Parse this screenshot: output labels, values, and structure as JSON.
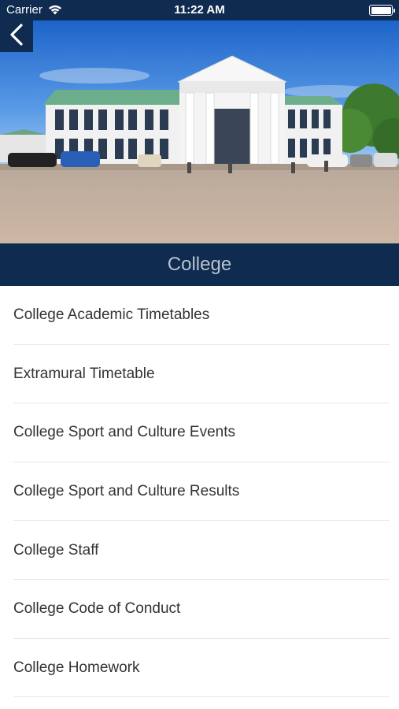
{
  "status_bar": {
    "carrier": "Carrier",
    "time": "11:22 AM",
    "battery_level": 1.0
  },
  "hero": {
    "description_icon": "college-building-photo"
  },
  "nav": {
    "back_icon": "chevron-left-icon"
  },
  "header": {
    "title": "College"
  },
  "menu": {
    "items": [
      {
        "label": "College Academic Timetables"
      },
      {
        "label": "Extramural Timetable"
      },
      {
        "label": "College Sport and Culture Events"
      },
      {
        "label": "College Sport and Culture Results"
      },
      {
        "label": "College Staff"
      },
      {
        "label": "College Code of Conduct"
      },
      {
        "label": "College Homework"
      }
    ]
  },
  "colors": {
    "navy": "#0f2b4f",
    "title_text": "#b9c3cf",
    "item_text": "#333333",
    "divider": "#e8e8e8"
  }
}
